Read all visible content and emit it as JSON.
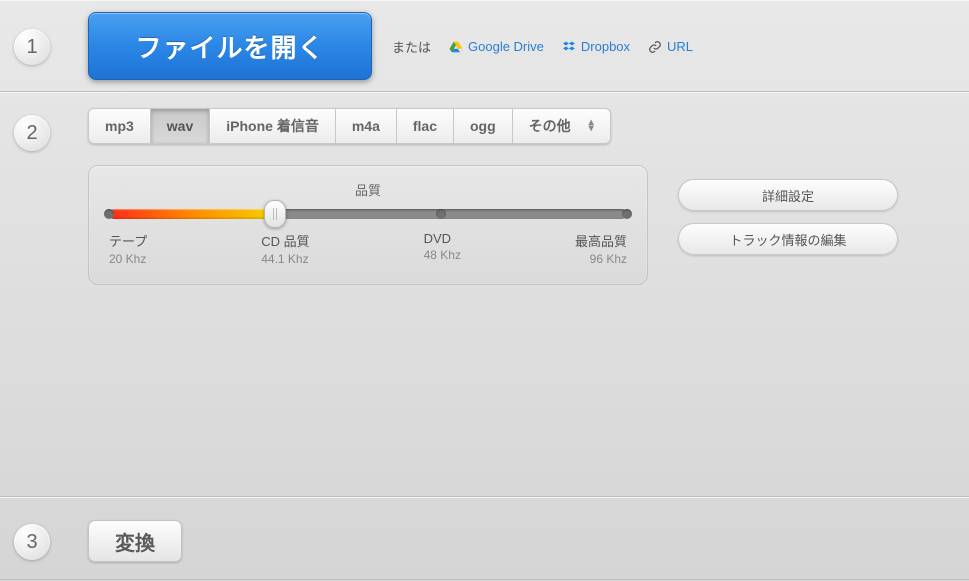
{
  "steps": {
    "s1": "1",
    "s2": "2",
    "s3": "3"
  },
  "open_button": "ファイルを開く",
  "alt": {
    "or": "または",
    "gdrive": "Google Drive",
    "dropbox": "Dropbox",
    "url": "URL"
  },
  "formats": {
    "mp3": "mp3",
    "wav": "wav",
    "iphone": "iPhone 着信音",
    "m4a": "m4a",
    "flac": "flac",
    "ogg": "ogg",
    "other": "その他",
    "selected": "wav"
  },
  "quality": {
    "title": "品質",
    "percent": 32,
    "stops": [
      {
        "label": "テープ",
        "sub": "20 Khz",
        "pos": 0
      },
      {
        "label": "CD 品質",
        "sub": "44.1 Khz",
        "pos": 32
      },
      {
        "label": "DVD",
        "sub": "48 Khz",
        "pos": 64
      },
      {
        "label": "最高品質",
        "sub": "96 Khz",
        "pos": 100
      }
    ]
  },
  "side": {
    "advanced": "詳細設定",
    "track_info": "トラック情報の編集"
  },
  "convert": "変換"
}
